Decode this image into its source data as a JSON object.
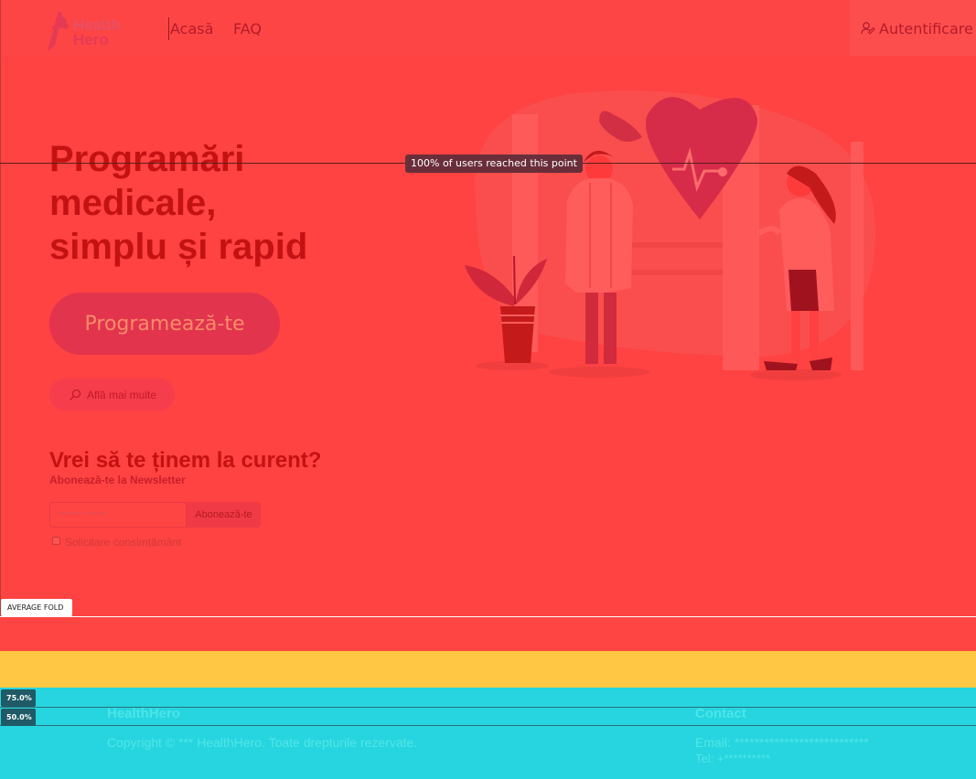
{
  "navbar": {
    "logo_text_line1": "Health",
    "logo_text_line2": "Hero",
    "links": [
      {
        "label": "Acasă"
      },
      {
        "label": "FAQ"
      }
    ],
    "login_label": "Autentificare"
  },
  "hero": {
    "title_lines": [
      "Programări",
      "medicale,",
      "simplu și rapid"
    ],
    "cta_label": "Programează-te",
    "more_label": "Află mai multe"
  },
  "newsletter": {
    "title": "Vrei să te ținem la curent?",
    "subtitle": "Abonează-te la Newsletter",
    "input_placeholder": "******* * ******",
    "button_label": "Abonează-te",
    "consent_label": "Solicitare consimțământ"
  },
  "overlays": {
    "reach_label": "100% of users reached this point",
    "fold_label": "AVERAGE FOLD",
    "depth_75": "75.0%",
    "depth_50": "50.0%"
  },
  "footer": {
    "brand": "HealthHero",
    "copyright": "Copyright © *** HealthHero. Toate drepturile rezervate.",
    "contact_title": "Contact",
    "email": "Email: ***************************",
    "tel": "Tel:  +**********"
  },
  "colors": {
    "heatmap_red": "#ff4444",
    "heatmap_yellow": "#ffc744",
    "heatmap_teal": "#26d5df",
    "brand_pink": "#e2344d"
  }
}
